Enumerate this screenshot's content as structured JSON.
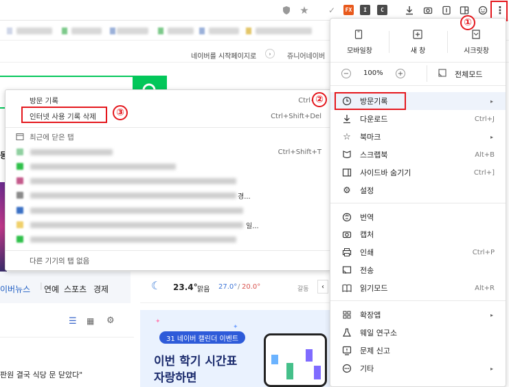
{
  "toolbar": {
    "ext_badges": [
      {
        "name": "fx-extension-icon",
        "label": "FX",
        "color": "#e8591c"
      },
      {
        "name": "i-extension-icon",
        "label": "I",
        "color": "#4a4a4a"
      },
      {
        "name": "c-extension-icon",
        "label": "C",
        "color": "#4a4a4a"
      }
    ]
  },
  "page": {
    "start_page_link": "네이버를 시작페이지로",
    "junior_link": "쥬니어네이버",
    "news_tabs": [
      "이버뉴스",
      "연예",
      "스포츠",
      "경제"
    ],
    "weather_temp": "23.4°",
    "weather_cond": "맑음",
    "weather_high": "27.0°",
    "weather_low": "20.0°",
    "weather_loc": "갈동",
    "promo_badge": "31 네이버 캘린더 이벤트",
    "promo_line1": "이번 학기 시간표",
    "promo_line2": "자랑하면",
    "headline_fragment": "판원 결국 식당 문 닫았다\"",
    "left_stub": "동",
    "news_left_fragment": "경...",
    "news_left_fragment2": "일..."
  },
  "main_menu": {
    "mobile_view": "모바일창",
    "new_window": "새 창",
    "secret_window": "시크릿창",
    "zoom_value": "100%",
    "zoom_minus": "−",
    "zoom_plus": "+",
    "fullscreen": "전체모드",
    "items": [
      {
        "label": "방문기록",
        "shortcut": "",
        "arrow": "▸"
      },
      {
        "label": "다운로드",
        "shortcut": "Ctrl+J",
        "arrow": ""
      },
      {
        "label": "북마크",
        "shortcut": "",
        "arrow": "▸"
      },
      {
        "label": "스크랩북",
        "shortcut": "Alt+B",
        "arrow": ""
      },
      {
        "label": "사이드바 숨기기",
        "shortcut": "Ctrl+]",
        "arrow": ""
      },
      {
        "label": "설정",
        "shortcut": "",
        "arrow": ""
      },
      {
        "label": "번역",
        "shortcut": "",
        "arrow": ""
      },
      {
        "label": "캡처",
        "shortcut": "",
        "arrow": ""
      },
      {
        "label": "인쇄",
        "shortcut": "Ctrl+P",
        "arrow": ""
      },
      {
        "label": "전송",
        "shortcut": "",
        "arrow": ""
      },
      {
        "label": "읽기모드",
        "shortcut": "Alt+R",
        "arrow": ""
      },
      {
        "label": "확장앱",
        "shortcut": "",
        "arrow": "▸"
      },
      {
        "label": "웨일 연구소",
        "shortcut": "",
        "arrow": ""
      },
      {
        "label": "문제 신고",
        "shortcut": "",
        "arrow": ""
      },
      {
        "label": "기타",
        "shortcut": "",
        "arrow": "▸"
      }
    ]
  },
  "history_submenu": {
    "history": "방문 기록",
    "history_shortcut": "Ctrl+H",
    "clear_data": "인터넷 사용 기록 삭제",
    "clear_shortcut": "Ctrl+Shift+Del",
    "recent_closed": "최근에 닫은 탭",
    "recent_shortcut": "Ctrl+Shift+T",
    "no_other_device": "다른 기기의 탭 없음"
  },
  "annotations": [
    "①",
    "②",
    "③"
  ]
}
